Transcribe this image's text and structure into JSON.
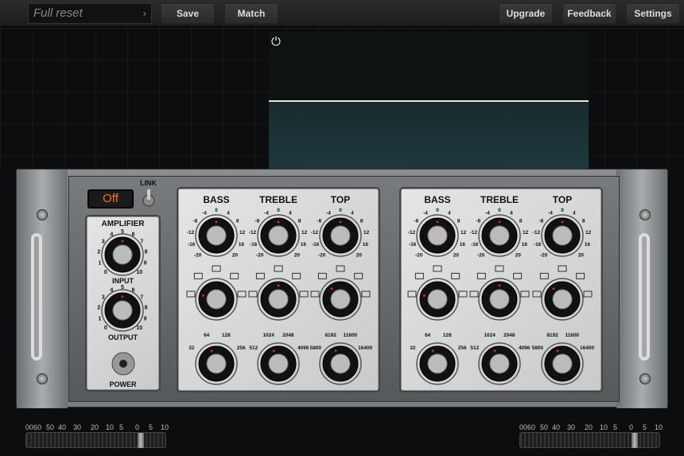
{
  "topbar": {
    "preset": "Full reset",
    "save": "Save",
    "match": "Match",
    "upgrade": "Upgrade",
    "feedback": "Feedback",
    "settings": "Settings"
  },
  "colors": {
    "off_text": "#e87a22",
    "curve": "#e8ead0",
    "display_fill": "#285a5f"
  },
  "rack": {
    "off_label": "Off",
    "link_label": "LINK",
    "amplifier": {
      "title": "AMPLIFIER",
      "input_label": "INPUT",
      "output_label": "OUTPUT",
      "power_label": "POWER",
      "input_value": 5,
      "output_value": 5,
      "scale": [
        "0",
        "1",
        "2",
        "3",
        "4",
        "5",
        "6",
        "7",
        "8",
        "9",
        "10"
      ]
    },
    "channels": [
      {
        "bands": [
          {
            "name": "BASS",
            "gain": 0,
            "shape": "low-shelf",
            "freq": "64",
            "freq_scale": [
              "32",
              "64",
              "128",
              "256"
            ]
          },
          {
            "name": "TREBLE",
            "gain": 0,
            "shape": "bell",
            "freq": "1024",
            "freq_scale": [
              "512",
              "1024",
              "2048",
              "4096"
            ]
          },
          {
            "name": "TOP",
            "gain": 0,
            "shape": "wide-bell",
            "freq": "8192",
            "freq_scale": [
              "5800",
              "8192",
              "11600",
              "16400"
            ]
          }
        ]
      },
      {
        "bands": [
          {
            "name": "BASS",
            "gain": 0,
            "shape": "low-shelf",
            "freq": "64",
            "freq_scale": [
              "32",
              "64",
              "128",
              "256"
            ]
          },
          {
            "name": "TREBLE",
            "gain": 0,
            "shape": "bell",
            "freq": "1024",
            "freq_scale": [
              "512",
              "1024",
              "2048",
              "4096"
            ]
          },
          {
            "name": "TOP",
            "gain": 0,
            "shape": "wide-bell",
            "freq": "8192",
            "freq_scale": [
              "5800",
              "8192",
              "11600",
              "16400"
            ]
          }
        ]
      }
    ],
    "gain_scale": [
      "-20",
      "-16",
      "-12",
      "-8",
      "-4",
      "0",
      "4",
      "8",
      "12",
      "16",
      "20"
    ]
  },
  "meters": {
    "scale": [
      "00",
      "60",
      "50",
      "40",
      "30",
      "20",
      "10",
      "5",
      "0",
      "5",
      "10"
    ],
    "left_value_db": 0,
    "right_value_db": 0
  }
}
